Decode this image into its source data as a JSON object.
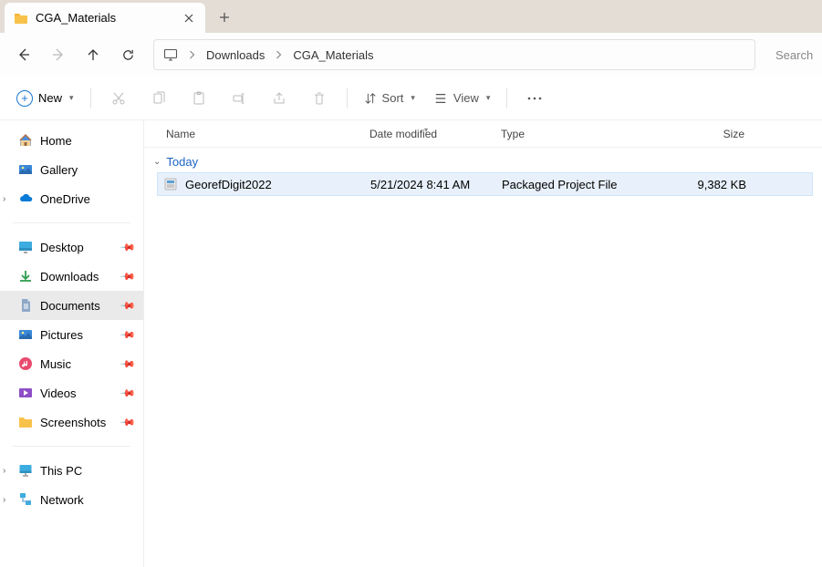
{
  "tab": {
    "title": "CGA_Materials"
  },
  "breadcrumbs": [
    "Downloads",
    "CGA_Materials"
  ],
  "search": {
    "placeholder": "Search"
  },
  "toolbar": {
    "new_label": "New",
    "sort_label": "Sort",
    "view_label": "View"
  },
  "sidebar": {
    "top": [
      {
        "label": "Home",
        "icon": "home"
      },
      {
        "label": "Gallery",
        "icon": "gallery"
      },
      {
        "label": "OneDrive",
        "icon": "onedrive",
        "expandable": true
      }
    ],
    "quick": [
      {
        "label": "Desktop",
        "icon": "desktop",
        "pinned": true
      },
      {
        "label": "Downloads",
        "icon": "downloads",
        "pinned": true
      },
      {
        "label": "Documents",
        "icon": "documents",
        "pinned": true,
        "selected": true
      },
      {
        "label": "Pictures",
        "icon": "pictures",
        "pinned": true
      },
      {
        "label": "Music",
        "icon": "music",
        "pinned": true
      },
      {
        "label": "Videos",
        "icon": "videos",
        "pinned": true
      },
      {
        "label": "Screenshots",
        "icon": "folder",
        "pinned": true
      }
    ],
    "bottom": [
      {
        "label": "This PC",
        "icon": "thispc",
        "expandable": true
      },
      {
        "label": "Network",
        "icon": "network",
        "expandable": true
      }
    ]
  },
  "columns": {
    "name": "Name",
    "date": "Date modified",
    "type": "Type",
    "size": "Size"
  },
  "group": {
    "label": "Today"
  },
  "files": [
    {
      "name": "GeorefDigit2022",
      "date": "5/21/2024 8:41 AM",
      "type": "Packaged Project File",
      "size": "9,382 KB"
    }
  ]
}
